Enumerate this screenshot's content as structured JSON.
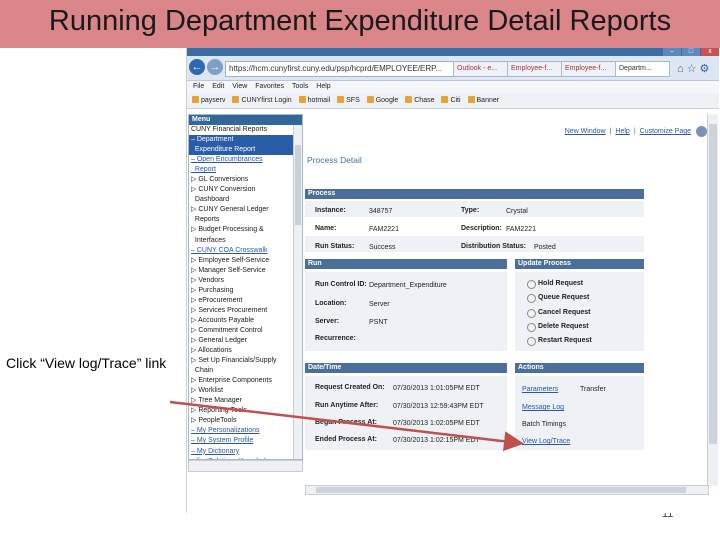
{
  "slide": {
    "title": "Running Department Expenditure Detail Reports",
    "note": "Click “View log/Trace” link",
    "page_number": "11"
  },
  "browser": {
    "url": "https://hcm.cunyfirst.cuny.edu/psp/hcprd/EMPLOYEE/ERP...",
    "tabs": [
      "Outlook - e...",
      "Employee-f...",
      "Employee-f...",
      "Departm..."
    ],
    "menu": [
      "File",
      "Edit",
      "View",
      "Favorites",
      "Tools",
      "Help"
    ],
    "favorites": [
      "payserv",
      "CUNYfirst Login",
      "hotmail",
      "SFS",
      "Google",
      "Chase",
      "Citi",
      "Banner"
    ]
  },
  "sidebar": {
    "title": "Menu",
    "items": [
      {
        "label": "CUNY Financial Reports",
        "style": "normal"
      },
      {
        "label": "– Department",
        "style": "selected"
      },
      {
        "label": "  Expenditure Report",
        "style": "selected"
      },
      {
        "label": "– Open Encumbrances",
        "style": "link"
      },
      {
        "label": "  Report",
        "style": "link"
      },
      {
        "label": "▷ GL Conversions",
        "style": "normal"
      },
      {
        "label": "▷ CUNY Conversion",
        "style": "normal"
      },
      {
        "label": "  Dashboard",
        "style": "normal"
      },
      {
        "label": "▷ CUNY General Ledger",
        "style": "normal"
      },
      {
        "label": "  Reports",
        "style": "normal"
      },
      {
        "label": "▷ Budget Processing &",
        "style": "normal"
      },
      {
        "label": "  Interfaces",
        "style": "normal"
      },
      {
        "label": "– CUNY COA Crosswalk",
        "style": "link"
      },
      {
        "label": "▷ Employee Self-Service",
        "style": "normal"
      },
      {
        "label": "▷ Manager Self-Service",
        "style": "normal"
      },
      {
        "label": "▷ Vendors",
        "style": "normal"
      },
      {
        "label": "▷ Purchasing",
        "style": "normal"
      },
      {
        "label": "▷ eProcurement",
        "style": "normal"
      },
      {
        "label": "▷ Services Procurement",
        "style": "normal"
      },
      {
        "label": "▷ Accounts Payable",
        "style": "normal"
      },
      {
        "label": "▷ Commitment Control",
        "style": "normal"
      },
      {
        "label": "▷ General Ledger",
        "style": "normal"
      },
      {
        "label": "▷ Allocations",
        "style": "normal"
      },
      {
        "label": "▷ Set Up Financials/Supply",
        "style": "normal"
      },
      {
        "label": "  Chain",
        "style": "normal"
      },
      {
        "label": "▷ Enterprise Components",
        "style": "normal"
      },
      {
        "label": "▷ Worklist",
        "style": "normal"
      },
      {
        "label": "▷ Tree Manager",
        "style": "normal"
      },
      {
        "label": "▷ Reporting Tools",
        "style": "normal"
      },
      {
        "label": "▷ PeopleTools",
        "style": "normal"
      },
      {
        "label": "– My Personalizations",
        "style": "link"
      },
      {
        "label": "– My System Profile",
        "style": "link"
      },
      {
        "label": "– My Dictionary",
        "style": "link"
      },
      {
        "label": "– firstSolutions Knowledge",
        "style": "link"
      }
    ]
  },
  "top_links": {
    "new_window": "New Window",
    "help": "Help",
    "customize": "Customize Page"
  },
  "page_title": "Process Detail",
  "process": {
    "header": "Process",
    "instance_label": "Instance:",
    "instance": "348757",
    "type_label": "Type:",
    "type": "Crystal",
    "name_label": "Name:",
    "name": "FAM2221",
    "description_label": "Description:",
    "description": "FAM2221",
    "run_status_label": "Run Status:",
    "run_status": "Success",
    "distribution_label": "Distribution Status:",
    "distribution": "Posted"
  },
  "run": {
    "header": "Run",
    "run_control_label": "Run Control ID:",
    "run_control": "Department_Expenditure",
    "location_label": "Location:",
    "location": "Server",
    "server_label": "Server:",
    "server": "PSNT",
    "recurrence_label": "Recurrence:"
  },
  "update_process": {
    "header": "Update Process",
    "options": [
      "Hold Request",
      "Queue Request",
      "Cancel Request",
      "Delete Request",
      "Restart Request"
    ]
  },
  "datetime": {
    "header": "Date/Time",
    "rows": [
      {
        "label": "Request Created On:",
        "value": "07/30/2013 1:01:05PM EDT"
      },
      {
        "label": "Run Anytime After:",
        "value": "07/30/2013 12:59:43PM EDT"
      },
      {
        "label": "Began Process At:",
        "value": "07/30/2013 1:02:05PM EDT"
      },
      {
        "label": "Ended Process At:",
        "value": "07/30/2013 1:02:15PM EDT"
      }
    ]
  },
  "actions": {
    "header": "Actions",
    "parameters": "Parameters",
    "transfer": "Transfer",
    "message_log": "Message Log",
    "batch_timings": "Batch Timings",
    "view_log": "View Log/Trace"
  },
  "colors": {
    "banner": "#d9858a",
    "arrow": "#c0504d",
    "panel_header": "#4a6f9a",
    "menu_header": "#336699"
  }
}
